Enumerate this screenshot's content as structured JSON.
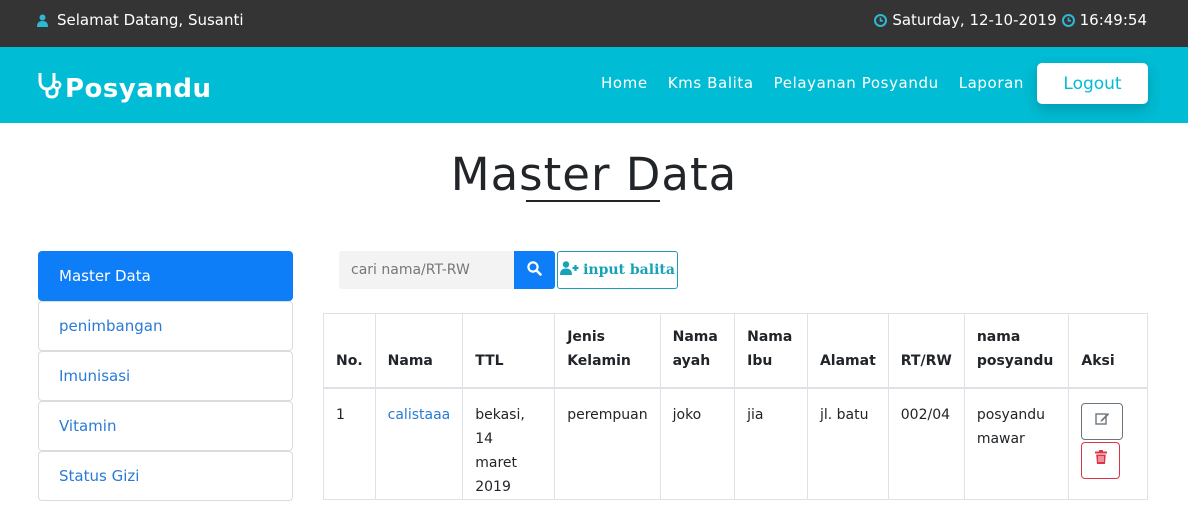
{
  "topbar": {
    "welcome": "Selamat Datang, Susanti",
    "date": "Saturday, 12-10-2019",
    "time": "16:49:54"
  },
  "navbar": {
    "brand": "Posyandu",
    "links": [
      "Home",
      "Kms Balita",
      "Pelayanan Posyandu",
      "Laporan"
    ],
    "logout": "Logout"
  },
  "page": {
    "title": "Master Data"
  },
  "sidebar": {
    "items": [
      {
        "label": "Master Data",
        "active": true
      },
      {
        "label": "penimbangan",
        "active": false
      },
      {
        "label": "Imunisasi",
        "active": false
      },
      {
        "label": "Vitamin",
        "active": false
      },
      {
        "label": "Status Gizi",
        "active": false
      }
    ]
  },
  "search": {
    "placeholder": "cari nama/RT-RW",
    "value": ""
  },
  "toolbar": {
    "input_balita": "input balita"
  },
  "table": {
    "headers": {
      "no": "No.",
      "nama": "Nama",
      "ttl": "TTL",
      "jenis_1": "Jenis",
      "jenis_2": "Kelamin",
      "ayah_1": "Nama",
      "ayah_2": "ayah",
      "ibu_1": "Nama",
      "ibu_2": "Ibu",
      "alamat": "Alamat",
      "rtrw": "RT/RW",
      "posyandu_1": "nama",
      "posyandu_2": "posyandu",
      "aksi": "Aksi"
    },
    "rows": [
      {
        "no": "1",
        "nama": "calistaaa",
        "ttl_1": "bekasi, 14",
        "ttl_2": "maret 2019",
        "jenis_kelamin": "perempuan",
        "nama_ayah": "joko",
        "nama_ibu": "jia",
        "alamat": "jl. batu",
        "rt_rw": "002/04",
        "posyandu_1": "posyandu",
        "posyandu_2": "mawar"
      }
    ]
  },
  "colors": {
    "topbar_bg": "#343434",
    "navbar_bg": "#00bcd4",
    "primary": "#0d7ef7",
    "info": "#17a2b8",
    "danger": "#dc3545",
    "link": "#2a7ad6"
  },
  "icons": {
    "user": "user-icon",
    "clock": "clock-icon",
    "brand": "stethoscope-icon",
    "search": "search-icon",
    "add_user": "user-plus-icon",
    "edit": "edit-icon",
    "delete": "trash-icon"
  }
}
